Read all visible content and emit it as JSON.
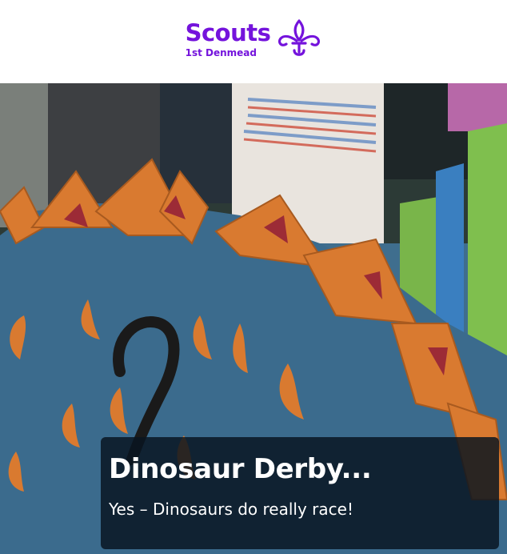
{
  "brand": {
    "name": "Scouts",
    "group": "1st Denmead",
    "emblem_icon": "fleur-de-lis-icon",
    "color": "#7413dc"
  },
  "hero": {
    "title": "Dinosaur Derby...",
    "description": "Yes – Dinosaurs do really race!"
  }
}
